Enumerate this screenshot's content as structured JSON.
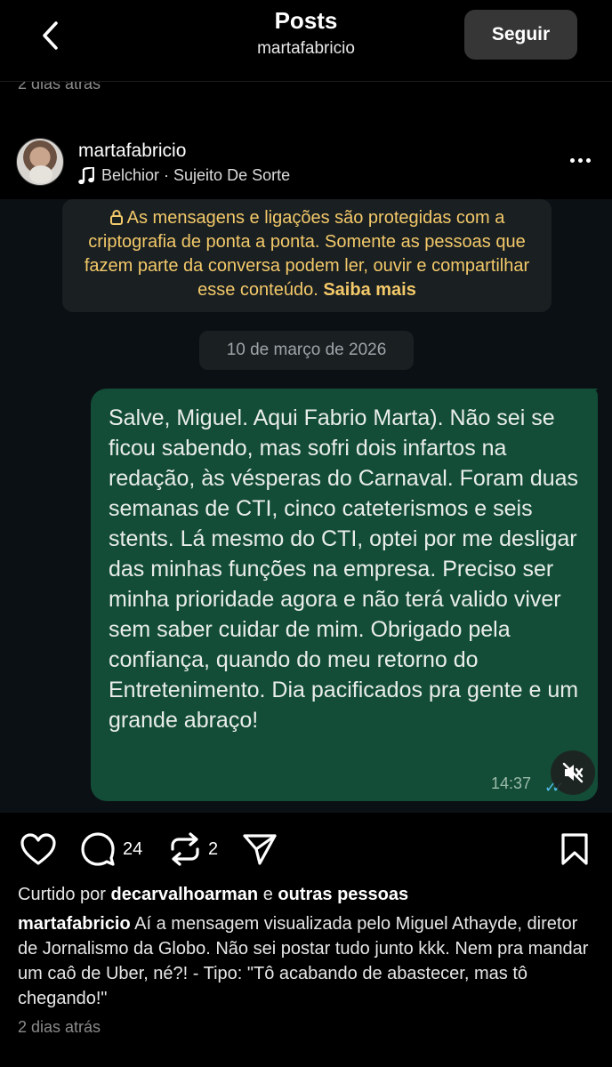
{
  "header": {
    "title": "Posts",
    "subtitle": "martafabricio",
    "follow_label": "Seguir"
  },
  "previous_post": {
    "time": "2 dias atrás"
  },
  "post": {
    "username": "martafabricio",
    "music": "Belchior · Sujeito De Sorte",
    "icons": [
      "chevron-left-icon",
      "music-note-icon",
      "more-icon",
      "lock-icon",
      "mute-icon",
      "heart-icon",
      "comment-icon",
      "repost-icon",
      "share-icon",
      "bookmark-icon"
    ]
  },
  "chat": {
    "notice_text": "As mensagens e ligações são protegidas com a criptografia de ponta a ponta. Somente as pessoas que fazem parte da conversa podem ler, ouvir e compartilhar esse conteúdo.",
    "notice_link": "Saiba mais",
    "date": "10 de março de 2026",
    "message": "Salve, Miguel. Aqui Fabrio Marta). Não sei se ficou sabendo, mas sofri dois infartos na redação, às vésperas do Carnaval. Foram duas semanas de CTI, cinco cateterismos e seis stents. Lá mesmo do CTI, optei por me desligar das minhas funções na empresa. Preciso ser minha prioridade agora e não terá valido viver sem saber cuidar de mim. Obrigado pela confiança, quando do meu retorno do Entretenimento. Dia pacificados pra gente e um grande abraço!",
    "time": "14:37",
    "bubble_color": "#134d37",
    "notice_color": "#f3c969"
  },
  "actions": {
    "comments": "24",
    "reposts": "2"
  },
  "likes": {
    "prefix": "Curtido por",
    "user": "decarvalhoarman",
    "connector": "e",
    "others": "outras pessoas"
  },
  "caption": {
    "username": "martafabricio",
    "text": "Aí a mensagem visualizada pelo Miguel Athayde, diretor de Jornalismo da Globo. Não sei postar tudo junto kkk. Nem pra mandar um caô de Uber, né?! - Tipo: \"Tô acabando de abastecer, mas tô chegando!\""
  },
  "post_time": "2 dias atrás"
}
